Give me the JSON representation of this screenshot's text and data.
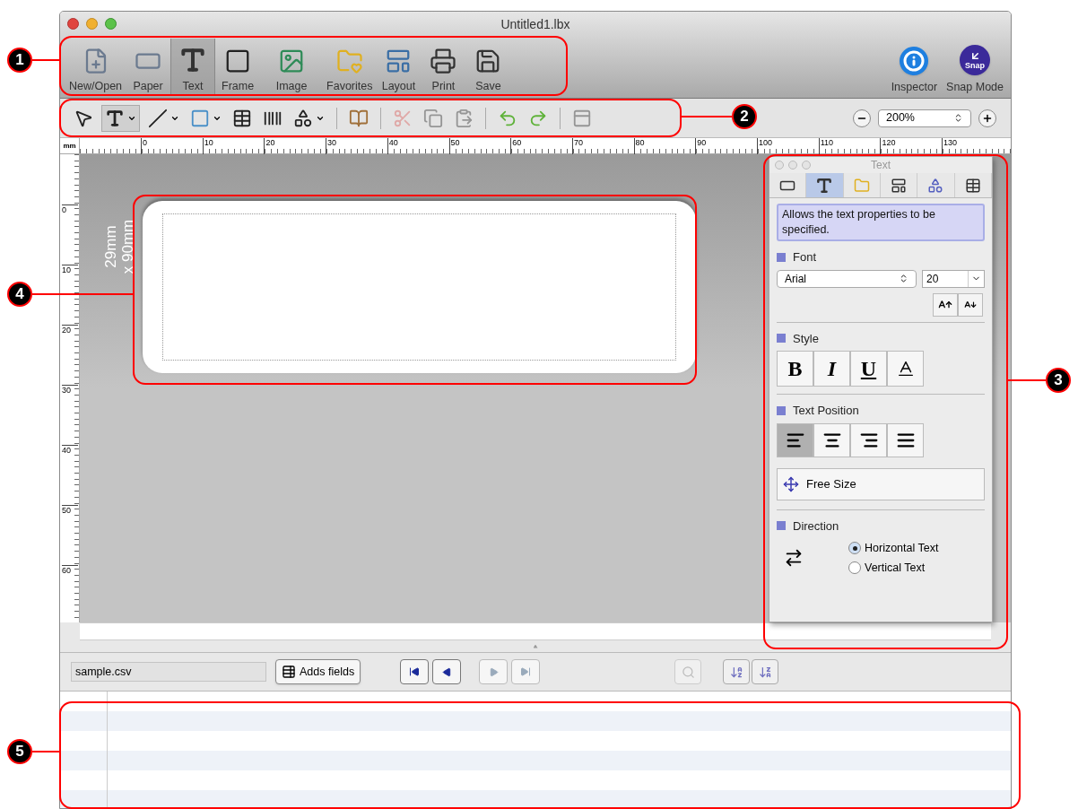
{
  "window": {
    "title": "Untitled1.lbx"
  },
  "toolbar": {
    "items": [
      {
        "kind": "new_open",
        "label": "New/Open",
        "selected": false
      },
      {
        "kind": "paper",
        "label": "Paper",
        "selected": false
      },
      {
        "kind": "text",
        "label": "Text",
        "selected": true
      },
      {
        "kind": "frame",
        "label": "Frame",
        "selected": false
      },
      {
        "kind": "image",
        "label": "Image",
        "selected": false
      },
      {
        "kind": "favorites",
        "label": "Favorites",
        "selected": false
      },
      {
        "kind": "layout",
        "label": "Layout",
        "selected": false
      },
      {
        "kind": "print",
        "label": "Print",
        "selected": false
      },
      {
        "kind": "save",
        "label": "Save",
        "selected": false
      }
    ],
    "right_items": [
      {
        "kind": "inspector",
        "label": "Inspector"
      },
      {
        "kind": "snap",
        "label": "Snap Mode",
        "badge": "Snap"
      }
    ]
  },
  "edit_toolbar": {
    "tools": [
      {
        "kind": "pointer",
        "selected": false,
        "caret": false,
        "disabled": false
      },
      {
        "kind": "text",
        "selected": true,
        "caret": true,
        "disabled": false
      },
      {
        "kind": "line",
        "selected": false,
        "caret": true,
        "disabled": false
      },
      {
        "kind": "rectangle",
        "selected": false,
        "caret": true,
        "disabled": false
      },
      {
        "kind": "table",
        "selected": false,
        "caret": false,
        "disabled": false
      },
      {
        "kind": "barcode",
        "selected": false,
        "caret": false,
        "disabled": false
      },
      {
        "kind": "clipart",
        "selected": false,
        "caret": true,
        "disabled": false
      },
      {
        "kind": "separator"
      },
      {
        "kind": "database",
        "selected": false,
        "caret": false,
        "disabled": false
      },
      {
        "kind": "separator"
      },
      {
        "kind": "cut",
        "selected": false,
        "caret": false,
        "disabled": true
      },
      {
        "kind": "copy",
        "selected": false,
        "caret": false,
        "disabled": true
      },
      {
        "kind": "paste",
        "selected": false,
        "caret": false,
        "disabled": true
      },
      {
        "kind": "separator"
      },
      {
        "kind": "undo",
        "selected": false,
        "caret": false,
        "disabled": false
      },
      {
        "kind": "redo",
        "selected": false,
        "caret": false,
        "disabled": false
      },
      {
        "kind": "separator"
      },
      {
        "kind": "properties",
        "selected": false,
        "caret": false,
        "disabled": true
      }
    ],
    "zoom": "200%"
  },
  "ruler": {
    "unit": "mm",
    "h_ticks": [
      "0",
      "10",
      "20",
      "30",
      "40",
      "50",
      "60",
      "70",
      "80",
      "90",
      "100",
      "110",
      "120",
      "130"
    ],
    "v_ticks": [
      "0",
      "10",
      "20",
      "30",
      "40",
      "50",
      "60"
    ]
  },
  "canvas": {
    "size_lines": [
      "29mm",
      "x 90mm"
    ]
  },
  "text_panel": {
    "title": "Text",
    "tabs": [
      {
        "kind": "paper",
        "selected": false
      },
      {
        "kind": "text",
        "selected": true
      },
      {
        "kind": "favorites",
        "selected": false
      },
      {
        "kind": "layout",
        "selected": false
      },
      {
        "kind": "object",
        "selected": false
      },
      {
        "kind": "table",
        "selected": false
      }
    ],
    "description": "Allows the text properties to be specified.",
    "font": {
      "heading": "Font",
      "family": "Arial",
      "size": "20"
    },
    "style": {
      "heading": "Style",
      "buttons": [
        {
          "kind": "bold",
          "label": "B"
        },
        {
          "kind": "italic",
          "label": "I"
        },
        {
          "kind": "underline",
          "label": "U"
        },
        {
          "kind": "outline"
        }
      ]
    },
    "position": {
      "heading": "Text Position",
      "buttons": [
        {
          "kind": "left",
          "selected": true
        },
        {
          "kind": "center",
          "selected": false
        },
        {
          "kind": "right",
          "selected": false
        },
        {
          "kind": "justify",
          "selected": false
        }
      ],
      "size_button": "Free Size"
    },
    "direction": {
      "heading": "Direction",
      "options": [
        {
          "label": "Horizontal Text",
          "selected": true
        },
        {
          "label": "Vertical Text",
          "selected": false
        }
      ]
    }
  },
  "database": {
    "file": "sample.csv",
    "add_button": "Adds fields",
    "nav": [
      {
        "kind": "first",
        "disabled": false
      },
      {
        "kind": "prev",
        "disabled": false
      },
      {
        "kind": "next",
        "disabled": true
      },
      {
        "kind": "last",
        "disabled": true
      }
    ],
    "search_disabled": true,
    "sort": [
      {
        "kind": "az"
      },
      {
        "kind": "za"
      }
    ]
  },
  "callouts": [
    {
      "number": "1"
    },
    {
      "number": "2"
    },
    {
      "number": "3"
    },
    {
      "number": "4"
    },
    {
      "number": "5"
    }
  ]
}
